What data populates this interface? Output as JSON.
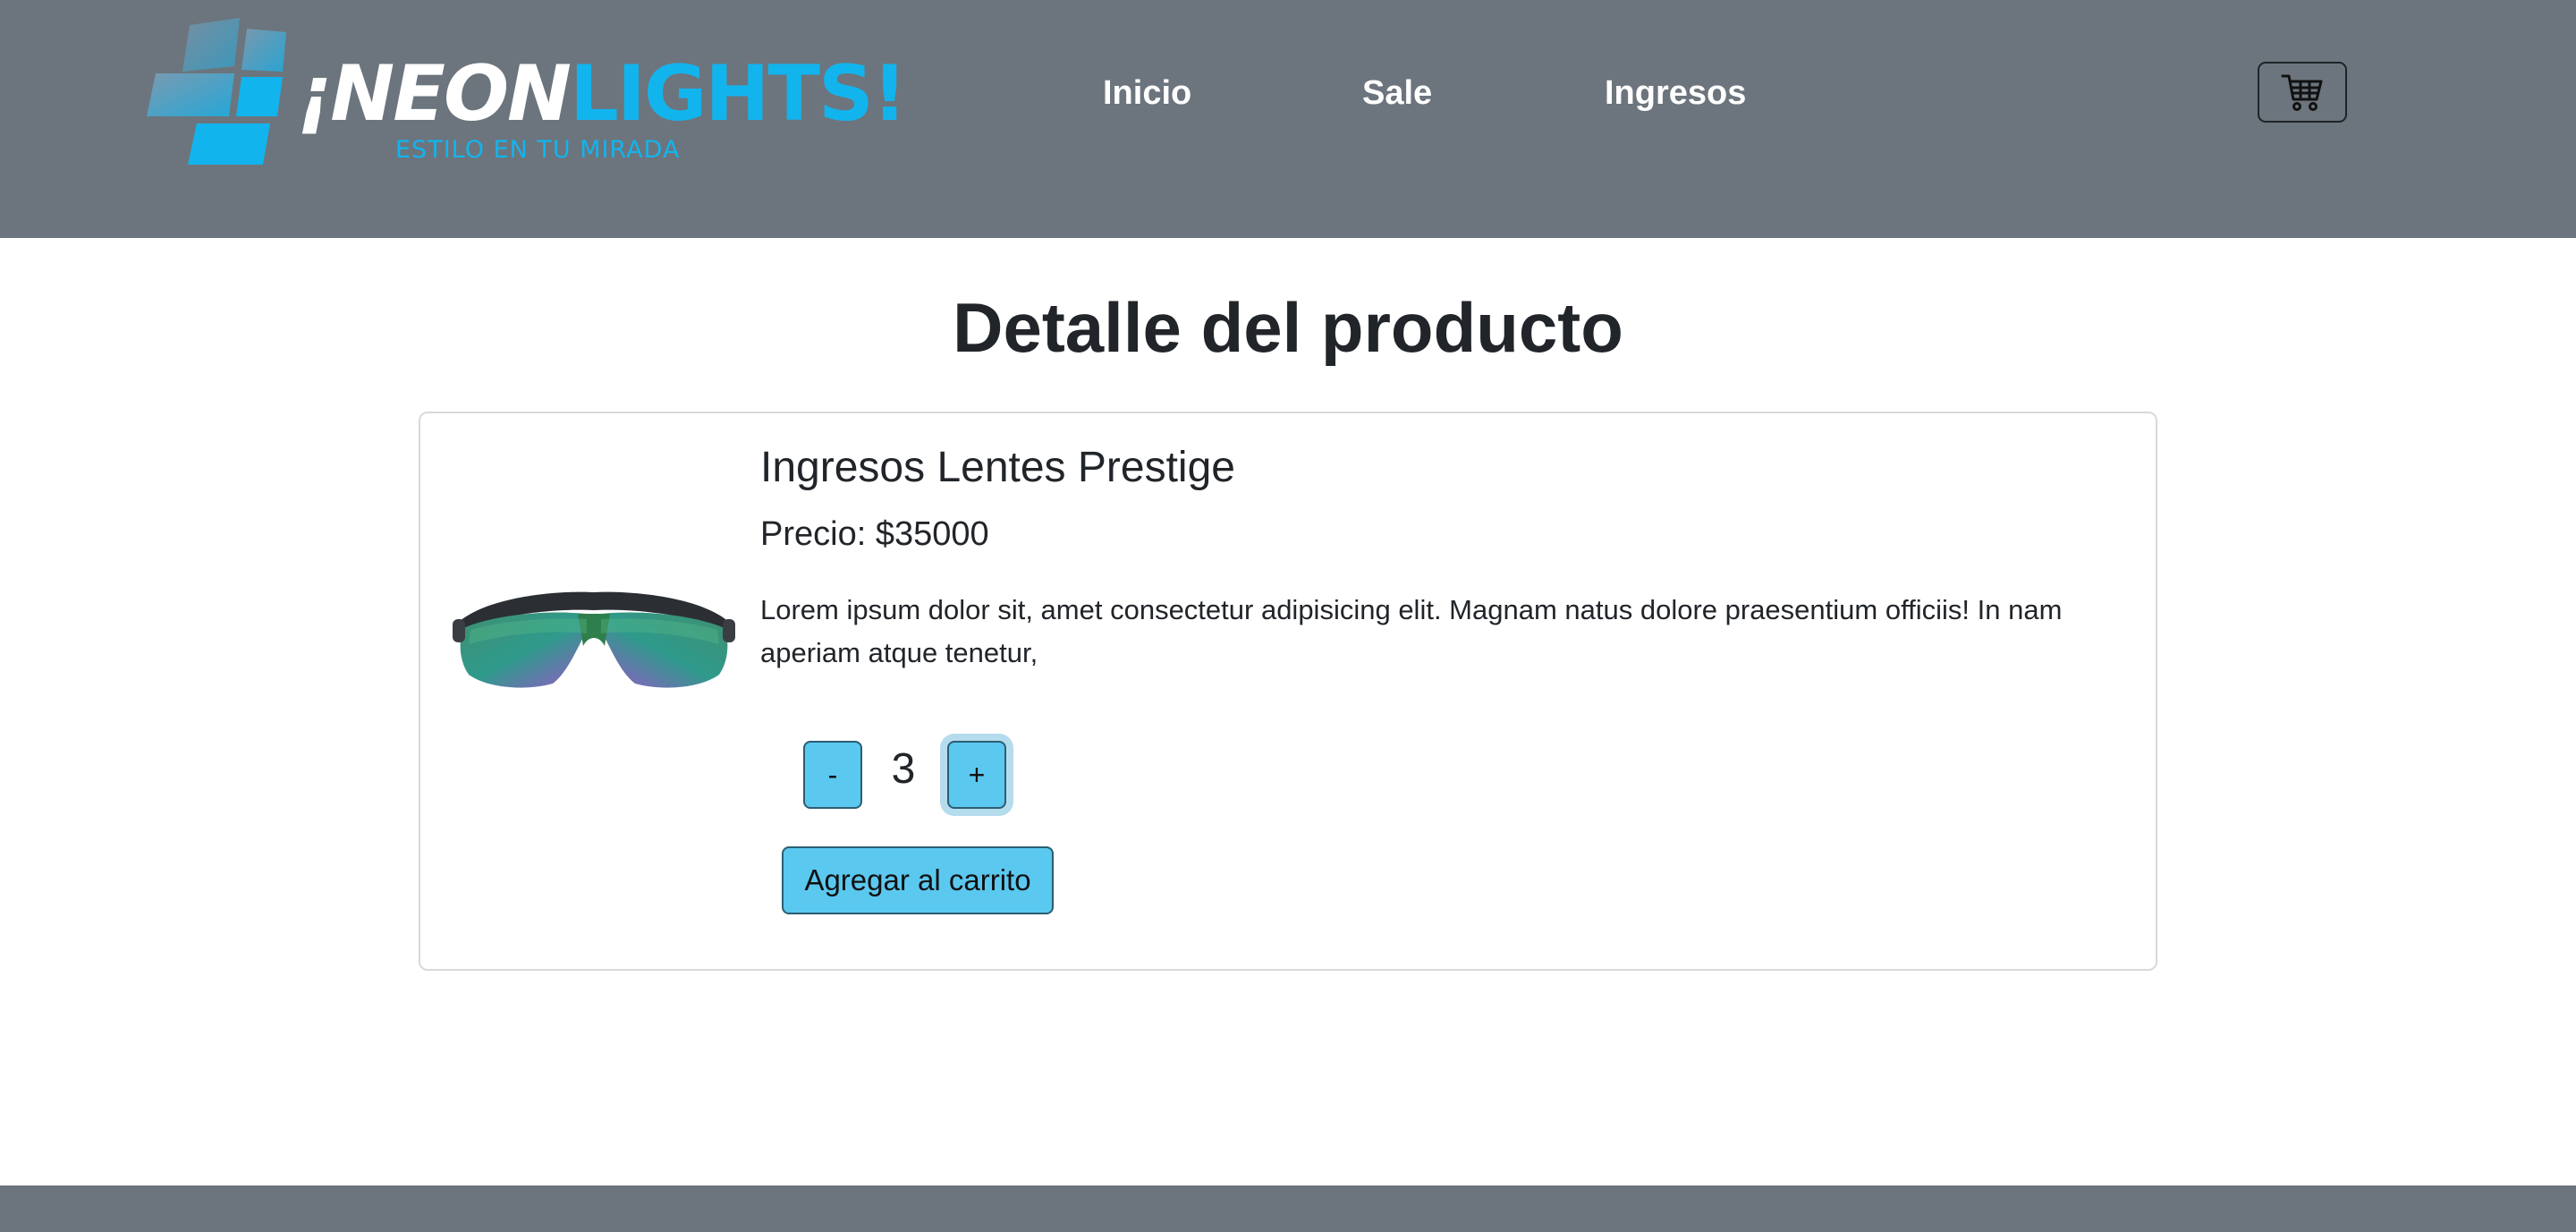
{
  "header": {
    "logo": {
      "prefix": "¡NEON",
      "highlight": "LIGHTS!",
      "tagline": "ESTILO EN TU MIRADA",
      "brand_color": "#12b4ee"
    },
    "nav": [
      {
        "label": "Inicio"
      },
      {
        "label": "Sale"
      },
      {
        "label": "Ingresos"
      }
    ],
    "cart_icon": "shopping-cart-icon",
    "background": "#6c757d"
  },
  "main": {
    "title": "Detalle del producto",
    "product": {
      "name": "Ingresos Lentes Prestige",
      "price": "Precio: $35000",
      "description": "Lorem ipsum dolor sit, amet consectetur adipisicing elit. Magnam natus dolore praesentium officiis! In nam aperiam atque tenetur,",
      "image": "sunglasses-image"
    },
    "quantity": {
      "minus_label": "-",
      "value": "3",
      "plus_label": "+"
    },
    "add_to_cart_label": "Agregar al carrito",
    "button_color": "#5bc8ef"
  }
}
